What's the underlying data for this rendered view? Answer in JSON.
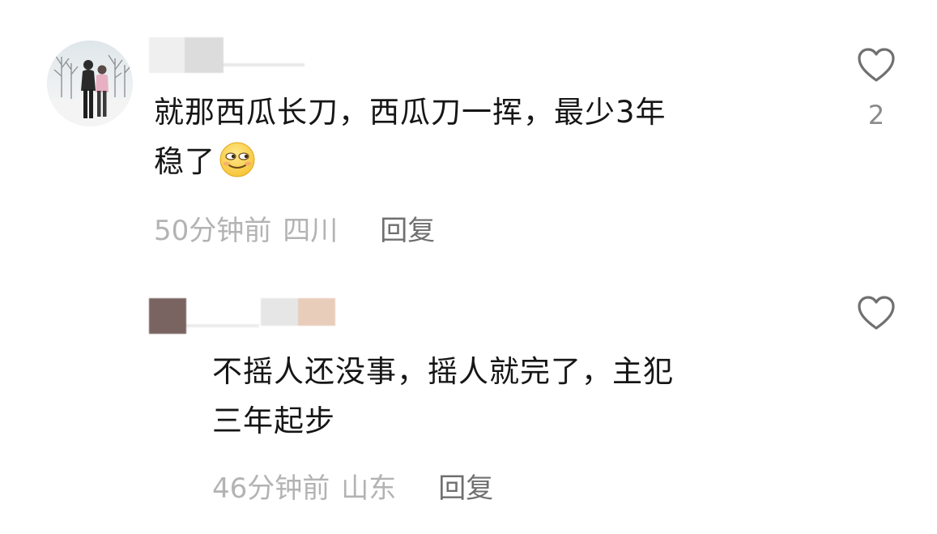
{
  "comments": [
    {
      "avatar_desc": "avatar-photo-couple-in-snow",
      "text_lines": [
        "就那西瓜长刀，西瓜刀一挥，最少3年",
        "稳了"
      ],
      "emoji_name": "smirk-emoji",
      "time": "50分钟前",
      "location": "四川",
      "reply_label": "回复",
      "likes": "2"
    },
    {
      "text_lines": [
        "不摇人还没事，摇人就完了，主犯",
        "三年起步"
      ],
      "time": "46分钟前",
      "location": "山东",
      "reply_label": "回复",
      "likes": ""
    }
  ],
  "colors": {
    "text": "#161616",
    "meta": "#b3b3b3",
    "reply": "#6f6f6f",
    "heart_stroke": "#707070"
  },
  "icons": {
    "like": "heart-outline-icon"
  }
}
